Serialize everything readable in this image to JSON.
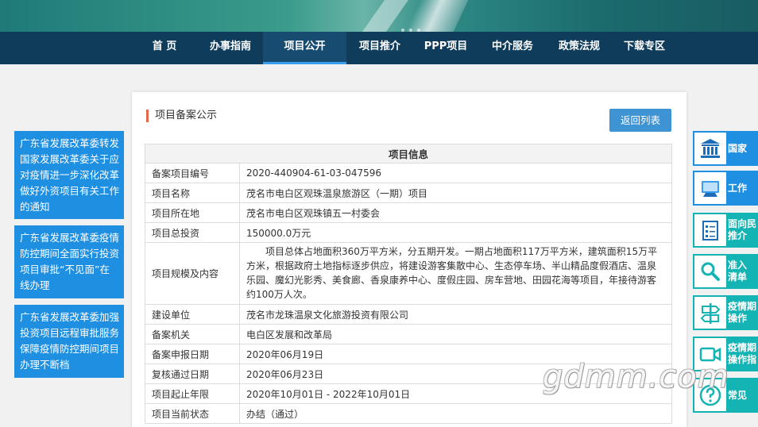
{
  "nav": {
    "items": [
      {
        "label": "首 页"
      },
      {
        "label": "办事指南"
      },
      {
        "label": "项目公开"
      },
      {
        "label": "项目推介"
      },
      {
        "label": "PPP项目"
      },
      {
        "label": "中介服务"
      },
      {
        "label": "政策法规"
      },
      {
        "label": "下载专区"
      }
    ],
    "active_index": 2
  },
  "notices": [
    {
      "text": "广东省发展改革委转发国家发展改革委关于应对疫情进一步深化改革做好外资项目有关工作的通知"
    },
    {
      "text": "广东省发展改革委疫情防控期间全面实行投资项目审批“不见面”在线办理"
    },
    {
      "text": "广东省发展改革委加强投资项目远程审批服务保障疫情防控期间项目办理不断档"
    }
  ],
  "panel": {
    "title": "项目备案公示",
    "back_button": "返回列表",
    "table_header": "项目信息",
    "rows": [
      {
        "key": "备案项目编号",
        "value": "2020-440904-61-03-047596"
      },
      {
        "key": "项目名称",
        "value": "茂名市电白区观珠温泉旅游区（一期）项目"
      },
      {
        "key": "项目所在地",
        "value": "茂名市电白区观珠镇五一村委会"
      },
      {
        "key": "项目总投资",
        "value": "150000.0万元"
      },
      {
        "key": "项目规模及内容",
        "value": "项目总体占地面积360万平方米，分五期开发。一期占地面积117万平方米，建筑面积15万平方米，根据政府土地指标逐步供应，将建设游客集散中心、生态停车场、半山精品度假酒店、温泉乐园、魔幻光影秀、美食廊、香泉康养中心、度假庄园、房车营地、田园花海等项目，年接待游客约100万人次。"
      },
      {
        "key": "建设单位",
        "value": "茂名市龙珠温泉文化旅游投资有限公司"
      },
      {
        "key": "备案机关",
        "value": "电白区发展和改革局"
      },
      {
        "key": "备案申报日期",
        "value": "2020年06月19日"
      },
      {
        "key": "复核通过日期",
        "value": "2020年06月23日"
      },
      {
        "key": "项目起止年限",
        "value": "2020年10月01日 - 2022年10月01日"
      },
      {
        "key": "项目当前状态",
        "value": "办结（通过）"
      }
    ]
  },
  "side_menu": [
    {
      "label": "国家",
      "icon": "government-building-icon",
      "color": "#1e8fe1"
    },
    {
      "label": "工作",
      "icon": "computer-icon",
      "color": "#1e8fe1"
    },
    {
      "label": "面向民\n推介",
      "icon": "document-list-icon",
      "color": "#15b4b4"
    },
    {
      "label": "准入\n清单",
      "icon": "search-icon",
      "color": "#15b4b4"
    },
    {
      "label": "疫情期\n操作",
      "icon": "signpost-icon",
      "color": "#15b4b4"
    },
    {
      "label": "疫情期\n操作指",
      "icon": "video-camera-icon",
      "color": "#15b4b4"
    },
    {
      "label": "常见",
      "icon": "question-icon",
      "color": "#15b4b4"
    }
  ],
  "watermark": "gdmm.com"
}
